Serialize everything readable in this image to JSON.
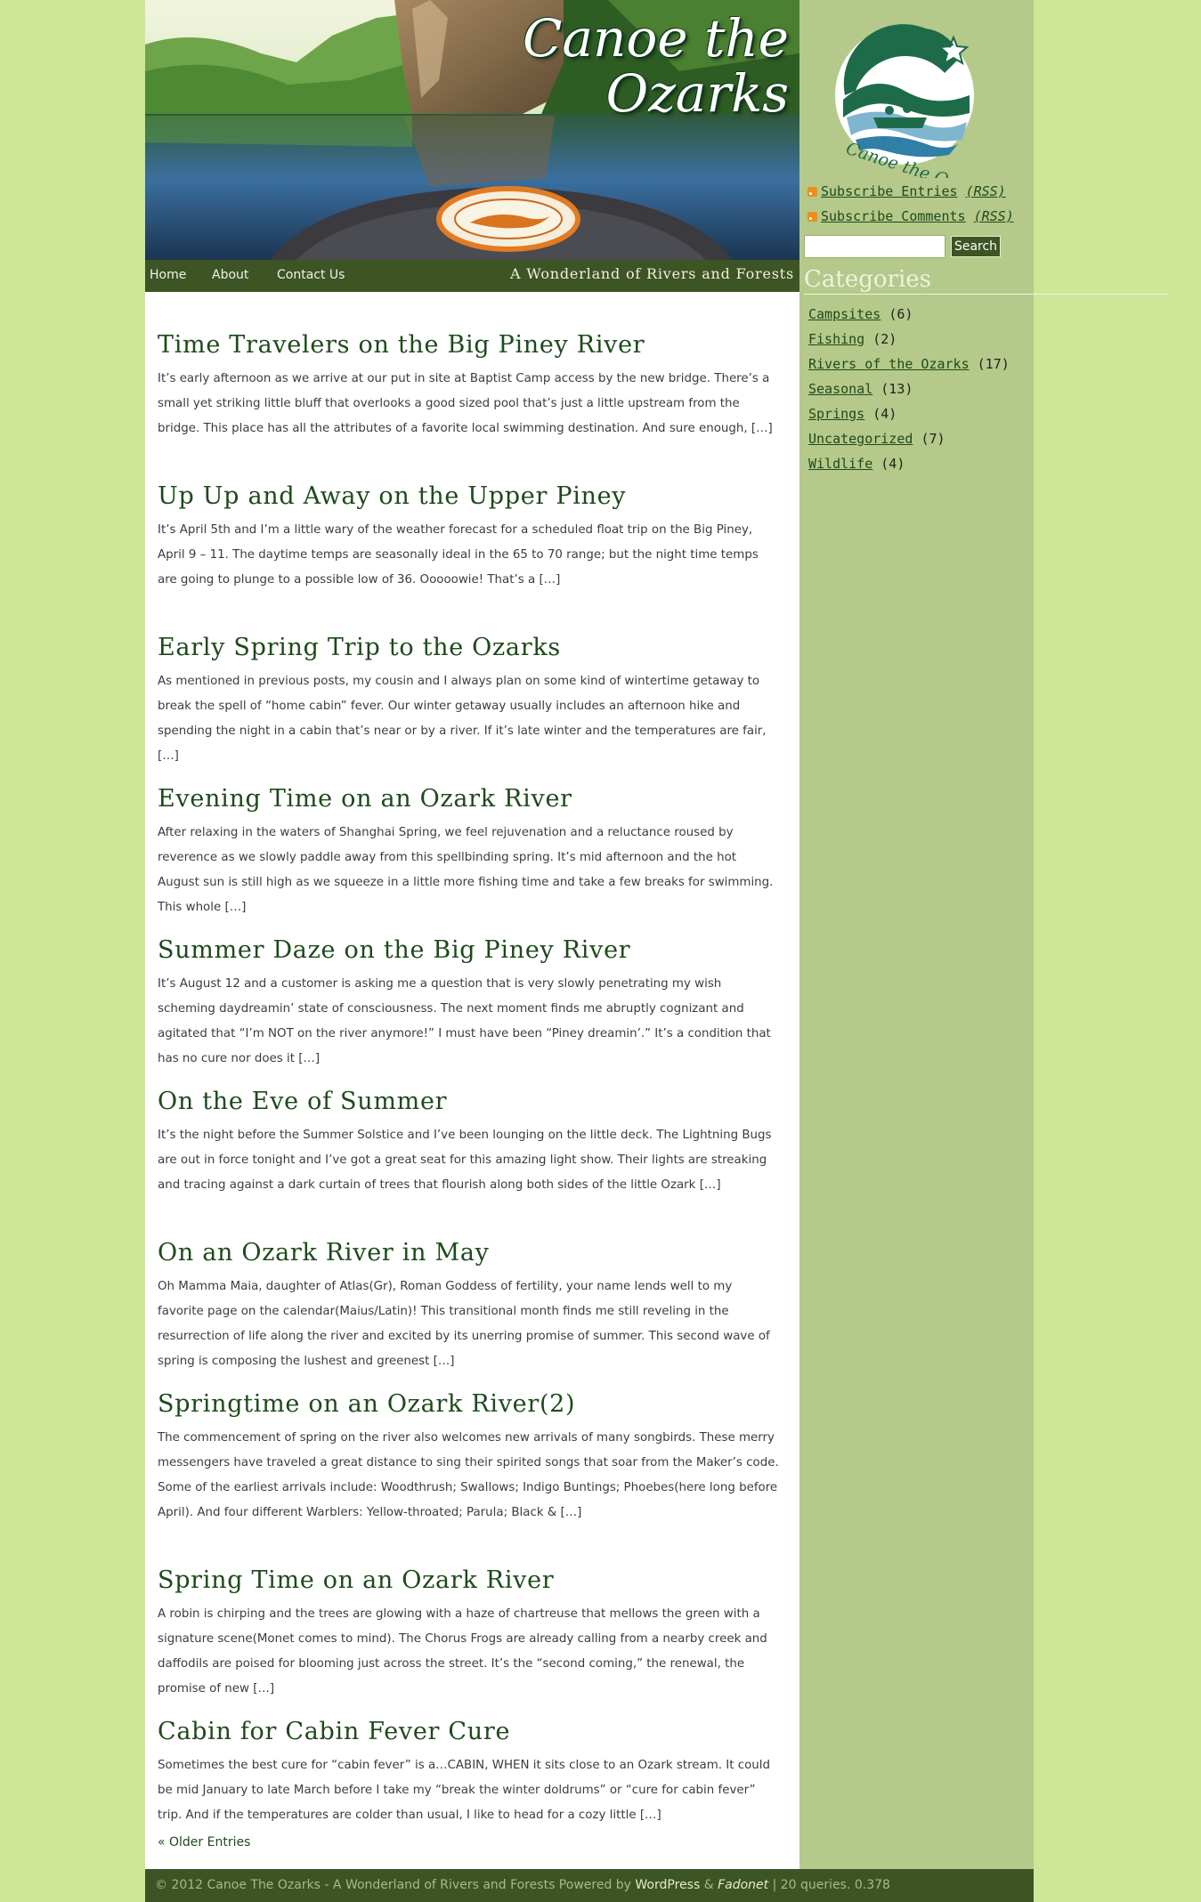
{
  "header": {
    "site_title_line1": "Canoe the",
    "site_title_line2": "Ozarks"
  },
  "nav": {
    "items": [
      "Home",
      "About",
      "Contact Us"
    ],
    "tagline": "A Wonderland of Rivers and Forests"
  },
  "posts": [
    {
      "title": "Time Travelers on the Big Piney River",
      "excerpt": "It’s early afternoon as we arrive at our put in site at Baptist Camp access by the new bridge.  There’s a small yet striking little bluff that overlooks a good sized pool that’s just a little upstream from the bridge.  This place has all the attributes of a favorite local swimming destination.  And sure enough, […]"
    },
    {
      "title": "Up Up and Away on the Upper Piney",
      "excerpt": "It’s April 5th and I’m a little wary of the weather forecast for a scheduled float trip on the Big Piney, April 9 – 11.  The daytime temps are seasonally ideal in the 65 to 70 range; but the night time temps are going to plunge to a possible low of 36. Ooooowie!  That’s a […]"
    },
    {
      "title": "Early Spring Trip to the Ozarks",
      "excerpt": "As mentioned in previous posts, my cousin and I always plan on some kind of wintertime getaway to break the spell of “home cabin” fever.  Our winter getaway usually includes an afternoon hike and spending the night in a cabin that’s near or by a river. If it’s late winter and the temperatures are fair, […]"
    },
    {
      "title": "Evening Time on an Ozark River",
      "excerpt": "After relaxing in the waters of Shanghai Spring, we feel rejuvenation and a reluctance roused by reverence as we slowly paddle away from this spellbinding spring. It’s mid afternoon and the hot August sun is still high as we squeeze in a little more fishing time and take a few breaks for swimming. This whole […]"
    },
    {
      "title": "Summer Daze on the Big Piney River",
      "excerpt": "It’s August 12 and a customer is asking me a question that is very slowly penetrating my wish scheming daydreamin’ state of consciousness.  The next moment finds me abruptly cognizant and agitated that  “I’m NOT on the river anymore!” I must have been “Piney dreamin’.”  It’s a condition that has no cure nor does it […]"
    },
    {
      "title": "On the Eve of Summer",
      "excerpt": "It’s the night before the Summer Solstice and I’ve been lounging on the little deck.  The Lightning Bugs are out in force tonight and I’ve got a great seat for this amazing light show. Their lights are streaking and tracing against a dark curtain of trees that flourish along both sides of the little Ozark […]"
    },
    {
      "title": "On an Ozark River in May",
      "excerpt": "Oh Mamma Maia, daughter of Atlas(Gr), Roman Goddess of fertility, your name lends well to my favorite page on the calendar(Maius/Latin)! This transitional month finds me still reveling in the resurrection of life along the river and excited by its unerring promise of summer.  This second wave of spring is composing the lushest and greenest […]"
    },
    {
      "title": "Springtime on an Ozark River(2)",
      "excerpt": "The commencement of spring on the river also welcomes new arrivals of many songbirds. These merry messengers have traveled a great distance to sing their spirited songs that soar from the Maker’s code. Some of the earliest arrivals include:  Woodthrush; Swallows; Indigo Buntings; Phoebes(here long before April).  And four different Warblers:  Yellow-throated; Parula; Black & […]"
    },
    {
      "title": "Spring Time on an Ozark River",
      "excerpt": "A robin is chirping and the trees are glowing with a haze of chartreuse that mellows the green with a signature scene(Monet comes to mind).  The Chorus Frogs are already calling from a nearby creek and daffodils are poised for blooming just across the street. It’s the “second coming,” the renewal, the promise of new […]"
    },
    {
      "title": "Cabin for Cabin Fever Cure",
      "excerpt": "Sometimes the best cure for “cabin fever” is a…CABIN, WHEN it sits close to an Ozark stream. It could be mid January to late March before I take my “break the winter doldrums” or “cure for cabin fever” trip.  And if the temperatures are colder than usual, I like to head for a cozy little […]"
    }
  ],
  "older_entries": "« Older Entries",
  "sidebar": {
    "logo_text": "Canoe the Ozarks",
    "feeds": [
      {
        "label": "Subscribe Entries",
        "suffix": "(RSS)",
        "icon": "rss-icon"
      },
      {
        "label": "Subscribe Comments",
        "suffix": "(RSS)",
        "icon": "rss-icon"
      }
    ],
    "search": {
      "value": "",
      "button_label": "Search"
    },
    "categories_heading": "Categories",
    "categories": [
      {
        "name": "Campsites",
        "count": "(6)"
      },
      {
        "name": "Fishing",
        "count": "(2)"
      },
      {
        "name": "Rivers of the Ozarks",
        "count": "(17)"
      },
      {
        "name": "Seasonal",
        "count": "(13)"
      },
      {
        "name": "Springs",
        "count": "(4)"
      },
      {
        "name": "Uncategorized",
        "count": "(7)"
      },
      {
        "name": "Wildlife",
        "count": "(4)"
      }
    ]
  },
  "footer": {
    "copyright": "© 2012 Canoe The Ozarks - A Wonderland of Rivers and Forests Powered by ",
    "wordpress": "WordPress",
    "amp": " & ",
    "theme": "Fadonet",
    "stats": " | 20 queries. 0.378"
  },
  "colors": {
    "page_background": "#cde797",
    "sidebar_background": "#b5c98a",
    "nav_background": "#3d5425",
    "title_green": "#1d4a1a"
  }
}
